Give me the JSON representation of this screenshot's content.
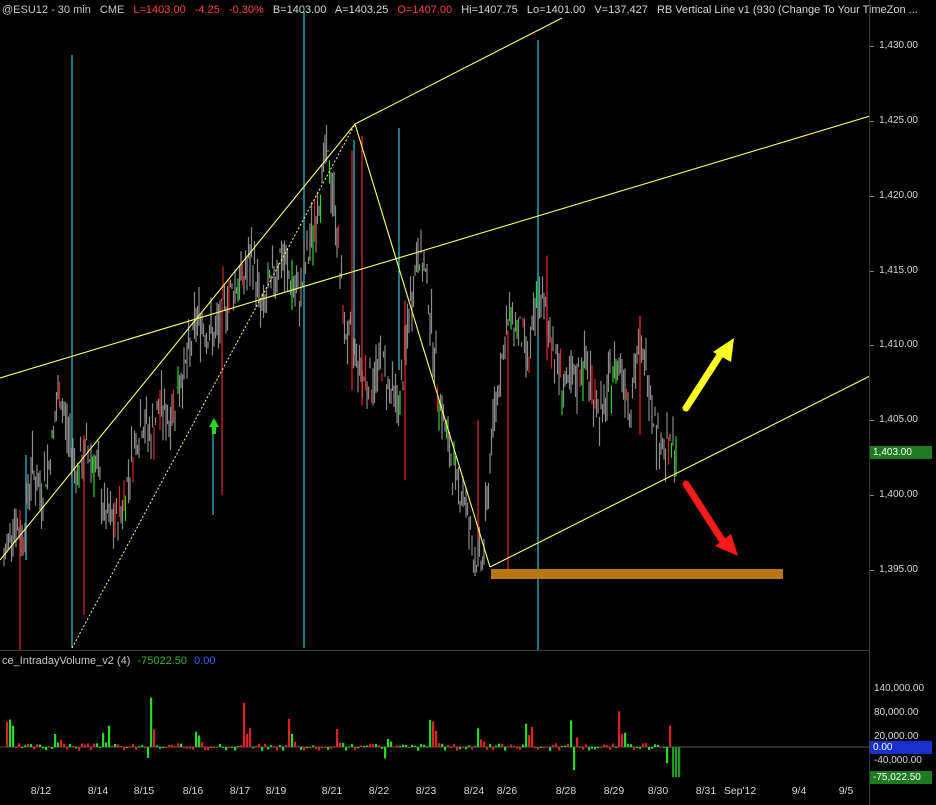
{
  "header": {
    "symbol": "@ESU12 - 30 min",
    "exchange": "CME",
    "low": "L=1403.00",
    "change": "-4.25",
    "change_pct": "-0.30%",
    "bid": "B=1403.00",
    "ask": "A=1403.25",
    "open": "O=1407.00",
    "high": "Hi=1407.75",
    "lo": "Lo=1401.00",
    "volume": "V=137,427",
    "study": "RB Vertical Line v1 (930 (Change To Your TimeZon ..."
  },
  "price_scale": {
    "labels": [
      "1,430.00",
      "1,425.00",
      "1,420.00",
      "1,415.00",
      "1,410.00",
      "1,405.00",
      "1,400.00",
      "1,395.00"
    ],
    "last_price": "1,403.00"
  },
  "volume": {
    "study_name": "ce_IntradayVolume_v2 (4)",
    "value": "-75022.50",
    "zero": "0.00",
    "labels": [
      "140,000.00",
      "80,000.00",
      "20,000.00",
      "-40,000.00"
    ],
    "zero_marker": "0.00",
    "last_marker": "-75,022.50"
  },
  "dates": [
    "8/12",
    "8/14",
    "8/15",
    "8/16",
    "8/17",
    "8/19",
    "8/21",
    "8/22",
    "8/23",
    "8/24",
    "8/26",
    "8/28",
    "8/29",
    "8/30",
    "8/31",
    "Sep'12",
    "9/4",
    "9/5"
  ],
  "colors": {
    "bar": "#8a8a8a",
    "up": "#22dd22",
    "down": "#dd2222",
    "channel": "#ffff66",
    "vline": "#33c6d6",
    "support": "#b8780f",
    "arrow_up": "#ffff22",
    "arrow_down": "#ff1a1a"
  },
  "chart_data": {
    "type": "candlestick",
    "interval": "30 min",
    "symbol": "@ESU12",
    "y_range": [
      1390,
      1432
    ],
    "path_points": [
      [
        0,
        1395.5
      ],
      [
        1,
        1398.5
      ],
      [
        2,
        1397
      ],
      [
        3,
        1402
      ],
      [
        4,
        1400
      ],
      [
        5,
        1402.5
      ],
      [
        6,
        1407
      ],
      [
        7,
        1404
      ],
      [
        8,
        1401.5
      ],
      [
        9,
        1403
      ],
      [
        10,
        1402
      ],
      [
        11,
        1398.5
      ],
      [
        12,
        1398
      ],
      [
        13,
        1399.5
      ],
      [
        14,
        1403
      ],
      [
        15,
        1405
      ],
      [
        16,
        1404
      ],
      [
        17,
        1406
      ],
      [
        18,
        1405
      ],
      [
        19,
        1407.5
      ],
      [
        20,
        1409
      ],
      [
        21,
        1412
      ],
      [
        22,
        1411
      ],
      [
        23,
        1410.5
      ],
      [
        24,
        1413
      ],
      [
        25,
        1414
      ],
      [
        26,
        1414.5
      ],
      [
        27,
        1416
      ],
      [
        28,
        1412
      ],
      [
        29,
        1414
      ],
      [
        30,
        1416
      ],
      [
        31,
        1414.5
      ],
      [
        32,
        1413
      ],
      [
        33,
        1416
      ],
      [
        34,
        1419
      ],
      [
        35,
        1423
      ],
      [
        36,
        1419
      ],
      [
        37,
        1411
      ],
      [
        38,
        1410
      ],
      [
        39,
        1408
      ],
      [
        40,
        1407.5
      ],
      [
        41,
        1409
      ],
      [
        42,
        1407
      ],
      [
        43,
        1406
      ],
      [
        44,
        1412
      ],
      [
        45,
        1416.5
      ],
      [
        46,
        1414
      ],
      [
        47,
        1408
      ],
      [
        48,
        1404
      ],
      [
        49,
        1401
      ],
      [
        50,
        1400
      ],
      [
        51,
        1396
      ],
      [
        52,
        1395.5
      ],
      [
        53,
        1404
      ],
      [
        54,
        1409
      ],
      [
        55,
        1412
      ],
      [
        56,
        1411
      ],
      [
        57,
        1409
      ],
      [
        58,
        1413
      ],
      [
        59,
        1412
      ],
      [
        60,
        1409
      ],
      [
        61,
        1407
      ],
      [
        62,
        1407.5
      ],
      [
        63,
        1409
      ],
      [
        64,
        1407
      ],
      [
        65,
        1405
      ],
      [
        66,
        1408
      ],
      [
        67,
        1409
      ],
      [
        68,
        1406
      ],
      [
        69,
        1410
      ],
      [
        70,
        1408
      ],
      [
        71,
        1404
      ],
      [
        72,
        1403
      ],
      [
        73,
        1403
      ]
    ],
    "volume_bars": "derived from intraday volume study",
    "annotations": {
      "swing_high": 1424.8,
      "swing_low": 1395.3,
      "support_zone": [
        1394.6,
        1395.2
      ]
    }
  }
}
